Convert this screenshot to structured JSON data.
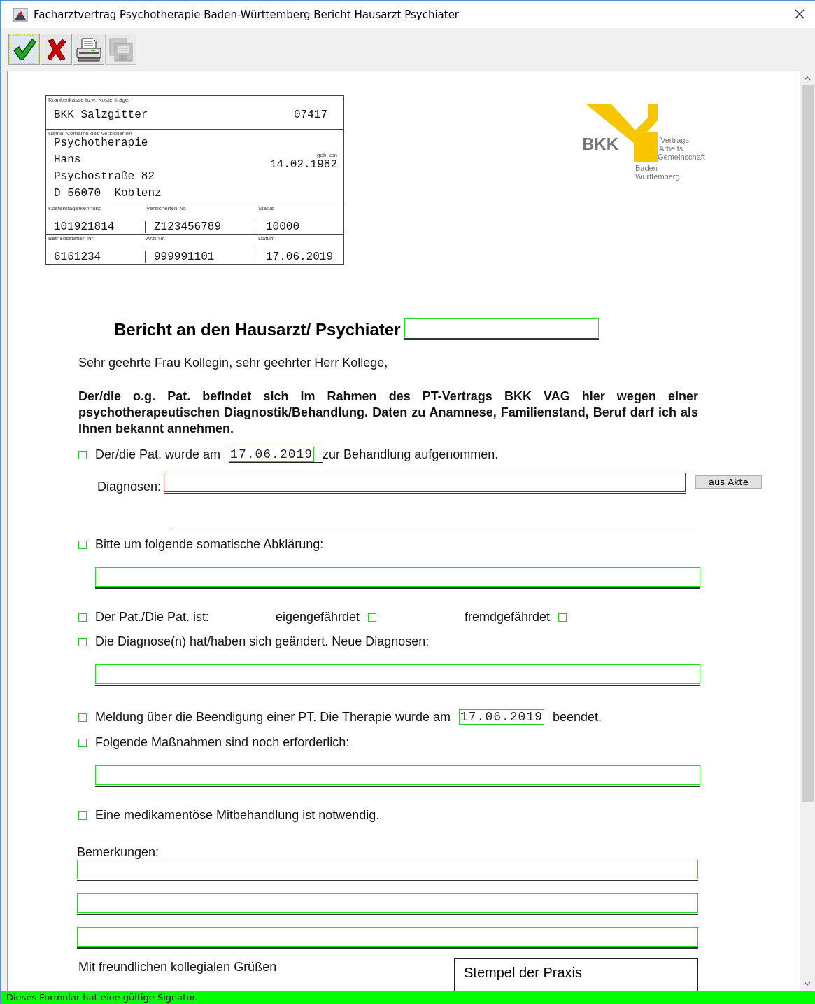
{
  "window": {
    "title": "Facharztvertrag Psychotherapie Baden-Württemberg Bericht Hausarzt Psychiater"
  },
  "toolbar": [
    {
      "kind": "confirm",
      "focused": true,
      "disabled": false
    },
    {
      "kind": "cancel",
      "focused": false,
      "disabled": false
    },
    {
      "kind": "print",
      "focused": false,
      "disabled": false
    },
    {
      "kind": "save",
      "focused": false,
      "disabled": true
    }
  ],
  "insurance_card": {
    "payer": {
      "label": "Krankenkasse bzw. Kostenträger",
      "name": "BKK Salzgitter",
      "number": "07417"
    },
    "insured": {
      "label": "Name, Vorname des Versicherten",
      "lines": [
        "Psychotherapie",
        "Hans",
        "Psychostraße 82",
        "D 56070  Koblenz"
      ],
      "birth_label": "geb. am",
      "birth_date": "14.02.1982"
    },
    "rows": [
      {
        "cells": [
          {
            "label": "Kostenträgerkennung",
            "value": "101921814"
          },
          {
            "label": "Versicherten-Nr.",
            "value": "Z123456789"
          },
          {
            "label": "Status",
            "value": "10000"
          }
        ]
      },
      {
        "cells": [
          {
            "label": "Betriebsstätten-Nr.",
            "value": "6161234"
          },
          {
            "label": "Arzt-Nr.",
            "value": "999991101"
          },
          {
            "label": "Datum",
            "value": "17.06.2019"
          }
        ]
      }
    ]
  },
  "logo": {
    "brand": "BKK",
    "lines": [
      "Vertrags",
      "Arbeits",
      "Gemeinschaft"
    ],
    "region": [
      "Baden-",
      "Württemberg"
    ]
  },
  "heading": "Bericht an den Hausarzt/ Psychiater",
  "salutation": "Sehr geehrte Frau Kollegin, sehr geehrter Herr Kollege,",
  "intro": "Der/die o.g. Pat. befindet sich im Rahmen des PT-Vertrags BKK VAG hier wegen einer psychotherapeutischen Diagnostik/Behandlung. Daten zu Anamnese, Familienstand, Beruf darf ich als Ihnen bekannt annehmen.",
  "items": [
    {
      "kind": "date_sentence",
      "checked": false,
      "before": "Der/die Pat. wurde am",
      "date": "17.06.2019",
      "after": "zur Behandlung aufgenommen."
    },
    {
      "kind": "diagnoses",
      "label": "Diagnosen:",
      "invalid": true,
      "button": "aus Akte"
    },
    {
      "kind": "check_field",
      "checked": false,
      "label": "Bitte um folgende somatische Abklärung:"
    },
    {
      "kind": "risk",
      "checked": false,
      "label": "Der Pat./Die Pat. ist:",
      "options": [
        {
          "label": "eigengefährdet",
          "checked": false
        },
        {
          "label": "fremdgefährdet",
          "checked": false
        }
      ]
    },
    {
      "kind": "check_field",
      "checked": false,
      "label": "Die Diagnose(n) hat/haben sich geändert. Neue Diagnosen:"
    },
    {
      "kind": "date_sentence",
      "checked": false,
      "before": "Meldung über die Beendigung einer PT. Die Therapie wurde am",
      "date": "17.06.2019",
      "after": "beendet."
    },
    {
      "kind": "check_field",
      "checked": false,
      "label": "Folgende Maßnahmen sind noch erforderlich:"
    },
    {
      "kind": "check",
      "checked": false,
      "label": "Eine medikamentöse Mitbehandlung ist notwendig."
    }
  ],
  "remarks": {
    "label": "Bemerkungen:",
    "fields": [
      {
        "kind": "line"
      },
      {
        "kind": "line"
      },
      {
        "kind": "line"
      }
    ]
  },
  "closing": "Mit freundlichen kollegialen Grüßen",
  "stamp": {
    "label": "Stempel der Praxis"
  },
  "status_bar": "Dieses Formular hat eine gültige Signatur."
}
